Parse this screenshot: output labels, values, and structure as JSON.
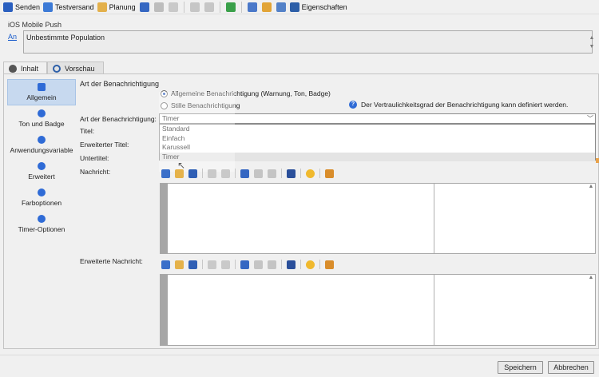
{
  "toolbar": {
    "send_label": "Senden",
    "test_send_label": "Testversand",
    "planning_label": "Planung",
    "properties_label": "Eigenschaften"
  },
  "header": {
    "section_title": "iOS Mobile Push",
    "an_link": "An",
    "population": "Unbestimmte Population"
  },
  "tabs": [
    {
      "label": "Inhalt",
      "icon": "apple-icon"
    },
    {
      "label": "Vorschau",
      "icon": "eye-icon"
    }
  ],
  "sidebar": {
    "items": [
      {
        "label": "Allgemein",
        "icon": "lock-icon"
      },
      {
        "label": "Ton und Badge",
        "icon": "gears-icon"
      },
      {
        "label": "Anwendungsvariable",
        "icon": "gears-icon"
      },
      {
        "label": "Erweitert",
        "icon": "gears-icon"
      },
      {
        "label": "Farboptionen",
        "icon": "gears-icon"
      },
      {
        "label": "Timer-Optionen",
        "icon": "gears-icon"
      }
    ]
  },
  "form": {
    "heading": "Art der Benachrichtigung",
    "radio_general": "Allgemeine Benachrichtigung (Warnung, Ton, Badge)",
    "radio_silent": "Stille Benachrichtigung",
    "info_text": "Der Vertraulichkeitsgrad der Benachrichtigung kann definiert werden.",
    "notification_type_label": "Art der Benachrichtigung:",
    "notification_type_value": "Timer",
    "options": [
      "Standard",
      "Einfach",
      "Karussell",
      "Timer"
    ],
    "title_label": "Titel:",
    "extended_title_label": "Erweiterter Titel:",
    "subtitle_label": "Untertitel:",
    "message_label": "Nachricht:",
    "extended_message_label": "Erweiterte Nachricht:"
  },
  "footer": {
    "save_label": "Speichern",
    "cancel_label": "Abbrechen"
  },
  "colors": {
    "accent": "#2f6bd6",
    "sidebar_active": "#c7d9ef",
    "link": "#1a5ccc"
  }
}
